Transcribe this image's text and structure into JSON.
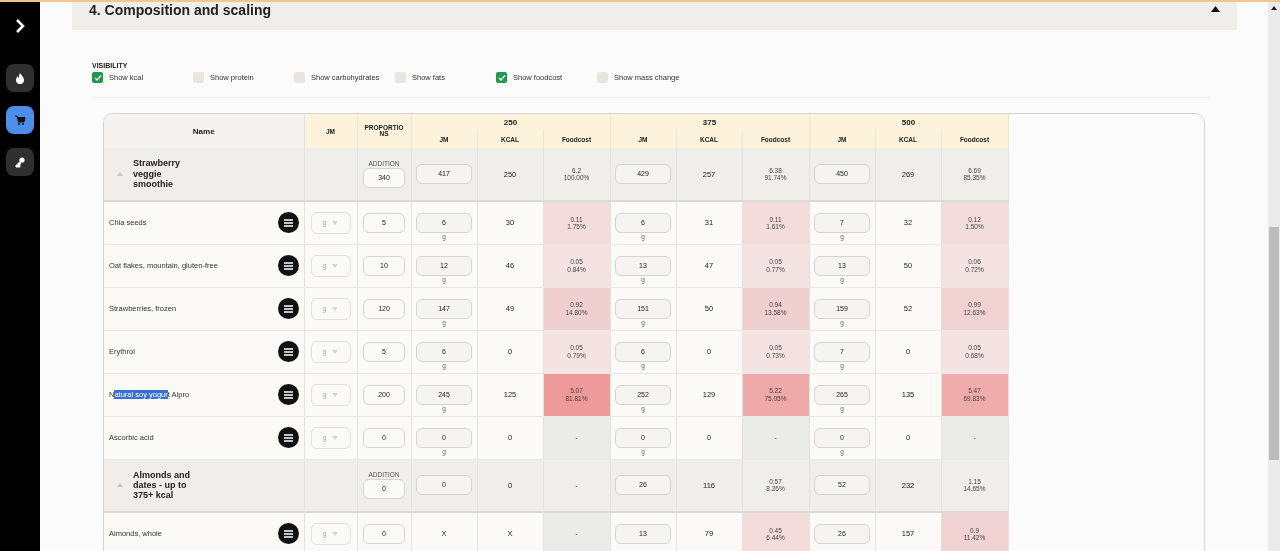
{
  "sidebar": {
    "items": [
      {
        "kind": "flame",
        "selected": false
      },
      {
        "kind": "cart",
        "selected": true
      },
      {
        "kind": "key",
        "selected": false
      }
    ]
  },
  "section": {
    "title": "4. Composition and scaling",
    "expanded": true
  },
  "visibility": {
    "label": "VISIBILITY",
    "options": [
      {
        "label": "Show kcal",
        "checked": true
      },
      {
        "label": "Show protein",
        "checked": false
      },
      {
        "label": "Show carbohydrates",
        "checked": false
      },
      {
        "label": "Show fats",
        "checked": false
      },
      {
        "label": "Show foodcost",
        "checked": true
      },
      {
        "label": "Show mass change",
        "checked": false
      }
    ]
  },
  "table": {
    "columns": {
      "name": "Name",
      "unit": "JM",
      "proportions": "PROPORTIONS"
    },
    "scales": [
      {
        "label": "250",
        "columns": [
          "JM",
          "KCAL",
          "Foodcost"
        ]
      },
      {
        "label": "375",
        "columns": [
          "JM",
          "KCAL",
          "Foodcost"
        ]
      },
      {
        "label": "500",
        "columns": [
          "JM",
          "KCAL",
          "Foodcost"
        ]
      }
    ],
    "rows": [
      {
        "kind": "group",
        "name": "Strawberry veggie smoothie",
        "addition_label": "ADDITION",
        "addition": "340",
        "scales": [
          {
            "jm": "417",
            "editable": true,
            "kcal": "250",
            "cost": "6.2",
            "share": "100.00%"
          },
          {
            "jm": "429",
            "editable": true,
            "kcal": "257",
            "cost": "6.38",
            "share": "91.74%"
          },
          {
            "jm": "450",
            "editable": true,
            "kcal": "269",
            "cost": "6.69",
            "share": "85.35%"
          }
        ]
      },
      {
        "kind": "ingredient",
        "name": "Chia seeds",
        "unit": "g",
        "proportion": "5",
        "scales": [
          {
            "jm": "6",
            "editable": true,
            "unit": "g",
            "kcal": "30",
            "cost": "0.11",
            "share": "1.75%",
            "color": "#f4dcdc"
          },
          {
            "jm": "6",
            "editable": true,
            "unit": "g",
            "kcal": "31",
            "cost": "0.11",
            "share": "1.61%",
            "color": "#f4dcdc"
          },
          {
            "jm": "7",
            "editable": true,
            "unit": "g",
            "kcal": "32",
            "cost": "0.12",
            "share": "1.50%",
            "color": "#f4dcdc"
          }
        ]
      },
      {
        "kind": "ingredient",
        "name": "Oat flakes, mountain, gluten-free",
        "unit": "g",
        "proportion": "10",
        "scales": [
          {
            "jm": "12",
            "editable": true,
            "unit": "g",
            "kcal": "46",
            "cost": "0.05",
            "share": "0.84%",
            "color": "#f5e2e2"
          },
          {
            "jm": "13",
            "editable": true,
            "unit": "g",
            "kcal": "47",
            "cost": "0.05",
            "share": "0.77%",
            "color": "#f5e2e2"
          },
          {
            "jm": "13",
            "editable": true,
            "unit": "g",
            "kcal": "50",
            "cost": "0.06",
            "share": "0.72%",
            "color": "#f5e2e2"
          }
        ]
      },
      {
        "kind": "ingredient",
        "name": "Strawberries, frozen",
        "unit": "g",
        "proportion": "120",
        "scales": [
          {
            "jm": "147",
            "editable": true,
            "unit": "g",
            "kcal": "49",
            "cost": "0.92",
            "share": "14.80%",
            "color": "#efcfd0"
          },
          {
            "jm": "151",
            "editable": true,
            "unit": "g",
            "kcal": "50",
            "cost": "0.94",
            "share": "13.58%",
            "color": "#efcfd0"
          },
          {
            "jm": "159",
            "editable": true,
            "unit": "g",
            "kcal": "52",
            "cost": "0.99",
            "share": "12.63%",
            "color": "#f0d2d2"
          }
        ]
      },
      {
        "kind": "ingredient",
        "name": "Erythrol",
        "unit": "g",
        "proportion": "5",
        "scales": [
          {
            "jm": "6",
            "editable": true,
            "unit": "g",
            "kcal": "0",
            "cost": "0.05",
            "share": "0.79%",
            "color": "#f5e2e2"
          },
          {
            "jm": "6",
            "editable": true,
            "unit": "g",
            "kcal": "0",
            "cost": "0.05",
            "share": "0.73%",
            "color": "#f5e2e2"
          },
          {
            "jm": "7",
            "editable": true,
            "unit": "g",
            "kcal": "0",
            "cost": "0.05",
            "share": "0.68%",
            "color": "#f5e2e2"
          }
        ]
      },
      {
        "kind": "ingredient",
        "name_segments": [
          {
            "text": "N",
            "selected": false
          },
          {
            "text": "atural soy yogur",
            "selected": true
          },
          {
            "text": "t Alpro",
            "selected": false
          }
        ],
        "unit": "g",
        "proportion": "200",
        "scales": [
          {
            "jm": "245",
            "editable": true,
            "unit": "g",
            "kcal": "125",
            "cost": "5.07",
            "share": "81.81%",
            "color": "#ee9a9a"
          },
          {
            "jm": "252",
            "editable": true,
            "unit": "g",
            "kcal": "129",
            "cost": "5.22",
            "share": "75.05%",
            "color": "#f0a9a9"
          },
          {
            "jm": "265",
            "editable": true,
            "unit": "g",
            "kcal": "135",
            "cost": "5.47",
            "share": "69.83%",
            "color": "#f0abab"
          }
        ]
      },
      {
        "kind": "ingredient",
        "name": "Ascorbic acid",
        "unit": "g",
        "proportion": "0",
        "scales": [
          {
            "jm": "0",
            "editable": true,
            "unit": "g",
            "kcal": "0",
            "cost": "-",
            "color": "#ebebe8"
          },
          {
            "jm": "0",
            "editable": true,
            "unit": "g",
            "kcal": "0",
            "cost": "-",
            "color": "#ebebe8"
          },
          {
            "jm": "0",
            "editable": true,
            "unit": "g",
            "kcal": "0",
            "cost": "-",
            "color": "#ebebe8"
          }
        ]
      },
      {
        "kind": "group",
        "name": "Almonds and dates - up to 375+ kcal",
        "addition_label": "ADDITION",
        "addition": "0",
        "scales": [
          {
            "jm": "0",
            "editable": true,
            "kcal": "0",
            "cost": "-"
          },
          {
            "jm": "26",
            "editable": true,
            "kcal": "116",
            "cost": "0.57",
            "share": "8.26%"
          },
          {
            "jm": "52",
            "editable": true,
            "kcal": "232",
            "cost": "1.15",
            "share": "14.65%"
          }
        ]
      },
      {
        "kind": "ingredient",
        "name": "Almonds, whole",
        "unit": "g",
        "proportion": "0",
        "scales": [
          {
            "jm": "X",
            "editable": false,
            "kcal": "X",
            "cost": "-",
            "color": "#ebebe8"
          },
          {
            "jm": "13",
            "editable": true,
            "kcal": "79",
            "cost": "0.45",
            "share": "6.44%",
            "color": "#f4dcdc"
          },
          {
            "jm": "26",
            "editable": true,
            "kcal": "157",
            "cost": "0.9",
            "share": "11.42%",
            "color": "#f0d2d2"
          }
        ]
      }
    ]
  }
}
